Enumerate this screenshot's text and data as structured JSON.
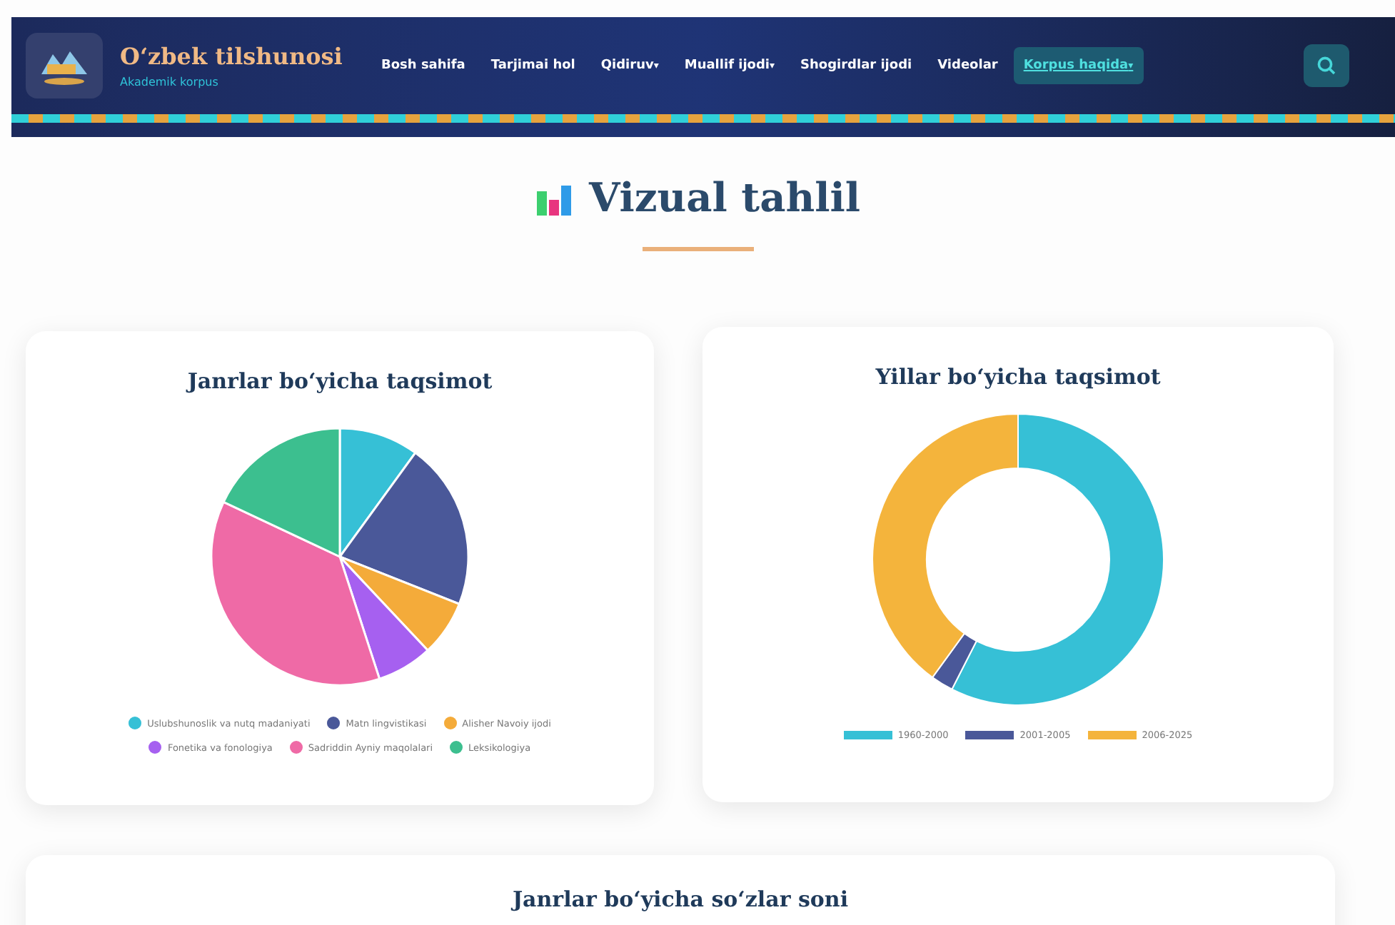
{
  "header": {
    "brand": "O‘zbek tilshunosi",
    "subtitle": "Akademik korpus",
    "nav": [
      {
        "label": "Bosh sahifa",
        "dropdown": false,
        "selected": false
      },
      {
        "label": "Tarjimai hol",
        "dropdown": false,
        "selected": false
      },
      {
        "label": "Qidiruv",
        "dropdown": true,
        "selected": false
      },
      {
        "label": "Muallif ijodi",
        "dropdown": true,
        "selected": false
      },
      {
        "label": "Shogirdlar ijodi",
        "dropdown": false,
        "selected": false
      },
      {
        "label": "Videolar",
        "dropdown": false,
        "selected": false
      },
      {
        "label": "Korpus haqida",
        "dropdown": true,
        "selected": true
      }
    ],
    "dropdown_mark": "▾"
  },
  "page_title": "Vizual tahlil",
  "genre_chart": {
    "title": "Janrlar bo‘yicha taqsimot",
    "legend": [
      {
        "label": "Uslubshunoslik va nutq madaniyati",
        "color": "#36c0d6"
      },
      {
        "label": "Matn lingvistikasi",
        "color": "#4a5899"
      },
      {
        "label": "Alisher Navoiy ijodi",
        "color": "#f4ab3a"
      },
      {
        "label": "Fonetika va fonologiya",
        "color": "#a660f0"
      },
      {
        "label": "Sadriddin Ayniy maqolalari",
        "color": "#ef6aa6"
      },
      {
        "label": "Leksikologiya",
        "color": "#3cbf8f"
      }
    ]
  },
  "year_chart": {
    "title": "Yillar bo‘yicha taqsimot",
    "legend": [
      {
        "label": "1960-2000",
        "color": "#36c0d6"
      },
      {
        "label": "2001-2005",
        "color": "#4a5899"
      },
      {
        "label": "2006-2025",
        "color": "#f4b43c"
      }
    ]
  },
  "words_chart": {
    "title": "Janrlar bo‘yicha so‘zlar soni"
  }
}
